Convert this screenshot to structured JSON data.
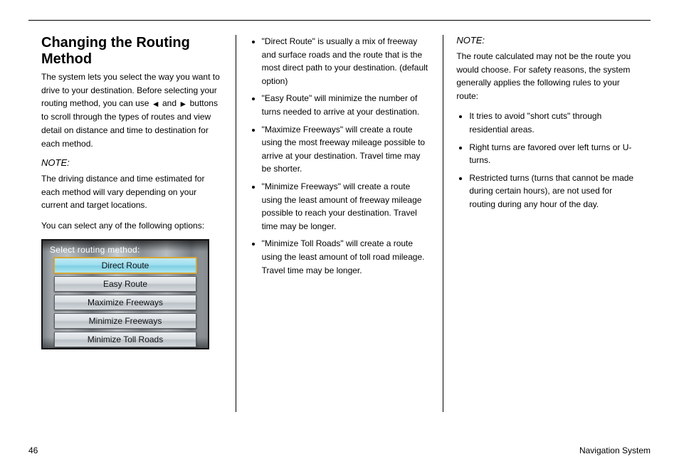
{
  "col1": {
    "heading": "Changing the Routing Method",
    "p1_a": "The system lets you select the way you want to drive to your destination. Before selecting your routing method, you can use ",
    "btn_left": "◄",
    "p1_b": " and ",
    "btn_right": "►",
    "p1_c": " buttons to scroll through the types of routes and view detail on distance and time to destination for each method.",
    "note": "NOTE:",
    "note_body": "The driving distance and time estimated for each method will vary depending on your current and target locations.",
    "p2": "You can select any of the following options:",
    "screenshot": {
      "title": "Select routing method:",
      "options": [
        {
          "label": "Direct Route",
          "selected": true
        },
        {
          "label": "Easy Route",
          "selected": false
        },
        {
          "label": "Maximize Freeways",
          "selected": false
        },
        {
          "label": "Minimize Freeways",
          "selected": false
        },
        {
          "label": "Minimize Toll Roads",
          "selected": false
        }
      ]
    }
  },
  "col2": {
    "items": [
      {
        "label": "\"Direct Route\"",
        "text": " is usually a mix of freeway and surface roads and the route that is the most direct path to your destination. (default option)"
      },
      {
        "label": "\"Easy Route\"",
        "text": " will minimize the number of turns needed to arrive at your destination."
      },
      {
        "label": "\"Maximize Freeways\"",
        "text": " will create a route using the most freeway mileage possible to arrive at your destination. Travel time may be shorter."
      },
      {
        "label": "\"Minimize Freeways\"",
        "text": " will create a route using the least amount of freeway mileage possible to reach your destination. Travel time may be longer."
      },
      {
        "label": "\"Minimize Toll Roads\"",
        "text": " will create a route using the least amount of toll road mileage. Travel time may be longer."
      }
    ]
  },
  "col3": {
    "note": "NOTE:",
    "note_body": "The route calculated may not be the route you would choose. For safety reasons, the system generally applies the following rules to your route:",
    "rules": [
      "It tries to avoid \"short cuts\" through residential areas.",
      "Right turns are favored over left turns or U-turns.",
      "Restricted turns (turns that cannot be made during certain hours), are not used for routing during any hour of the day."
    ]
  },
  "footer": {
    "left": "46",
    "right": "Navigation System"
  }
}
